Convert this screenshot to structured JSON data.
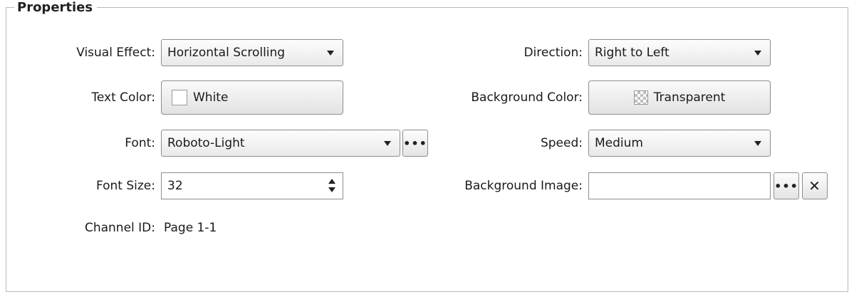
{
  "panel": {
    "title": "Properties"
  },
  "left": {
    "visual_effect": {
      "label": "Visual Effect:",
      "value": "Horizontal Scrolling"
    },
    "text_color": {
      "label": "Text Color:",
      "value": "White"
    },
    "font": {
      "label": "Font:",
      "value": "Roboto-Light",
      "browse_label": "•••"
    },
    "font_size": {
      "label": "Font Size:",
      "value": "32"
    },
    "channel_id": {
      "label": "Channel ID:",
      "value": "Page 1-1"
    }
  },
  "right": {
    "direction": {
      "label": "Direction:",
      "value": "Right to Left"
    },
    "background_color": {
      "label": "Background Color:",
      "value": "Transparent"
    },
    "speed": {
      "label": "Speed:",
      "value": "Medium"
    },
    "background_image": {
      "label": "Background Image:",
      "value": "",
      "browse_label": "•••",
      "clear_label": "✕"
    }
  },
  "colors": {
    "border": "#8d8d8d",
    "group_border": "#b9b9b9"
  }
}
